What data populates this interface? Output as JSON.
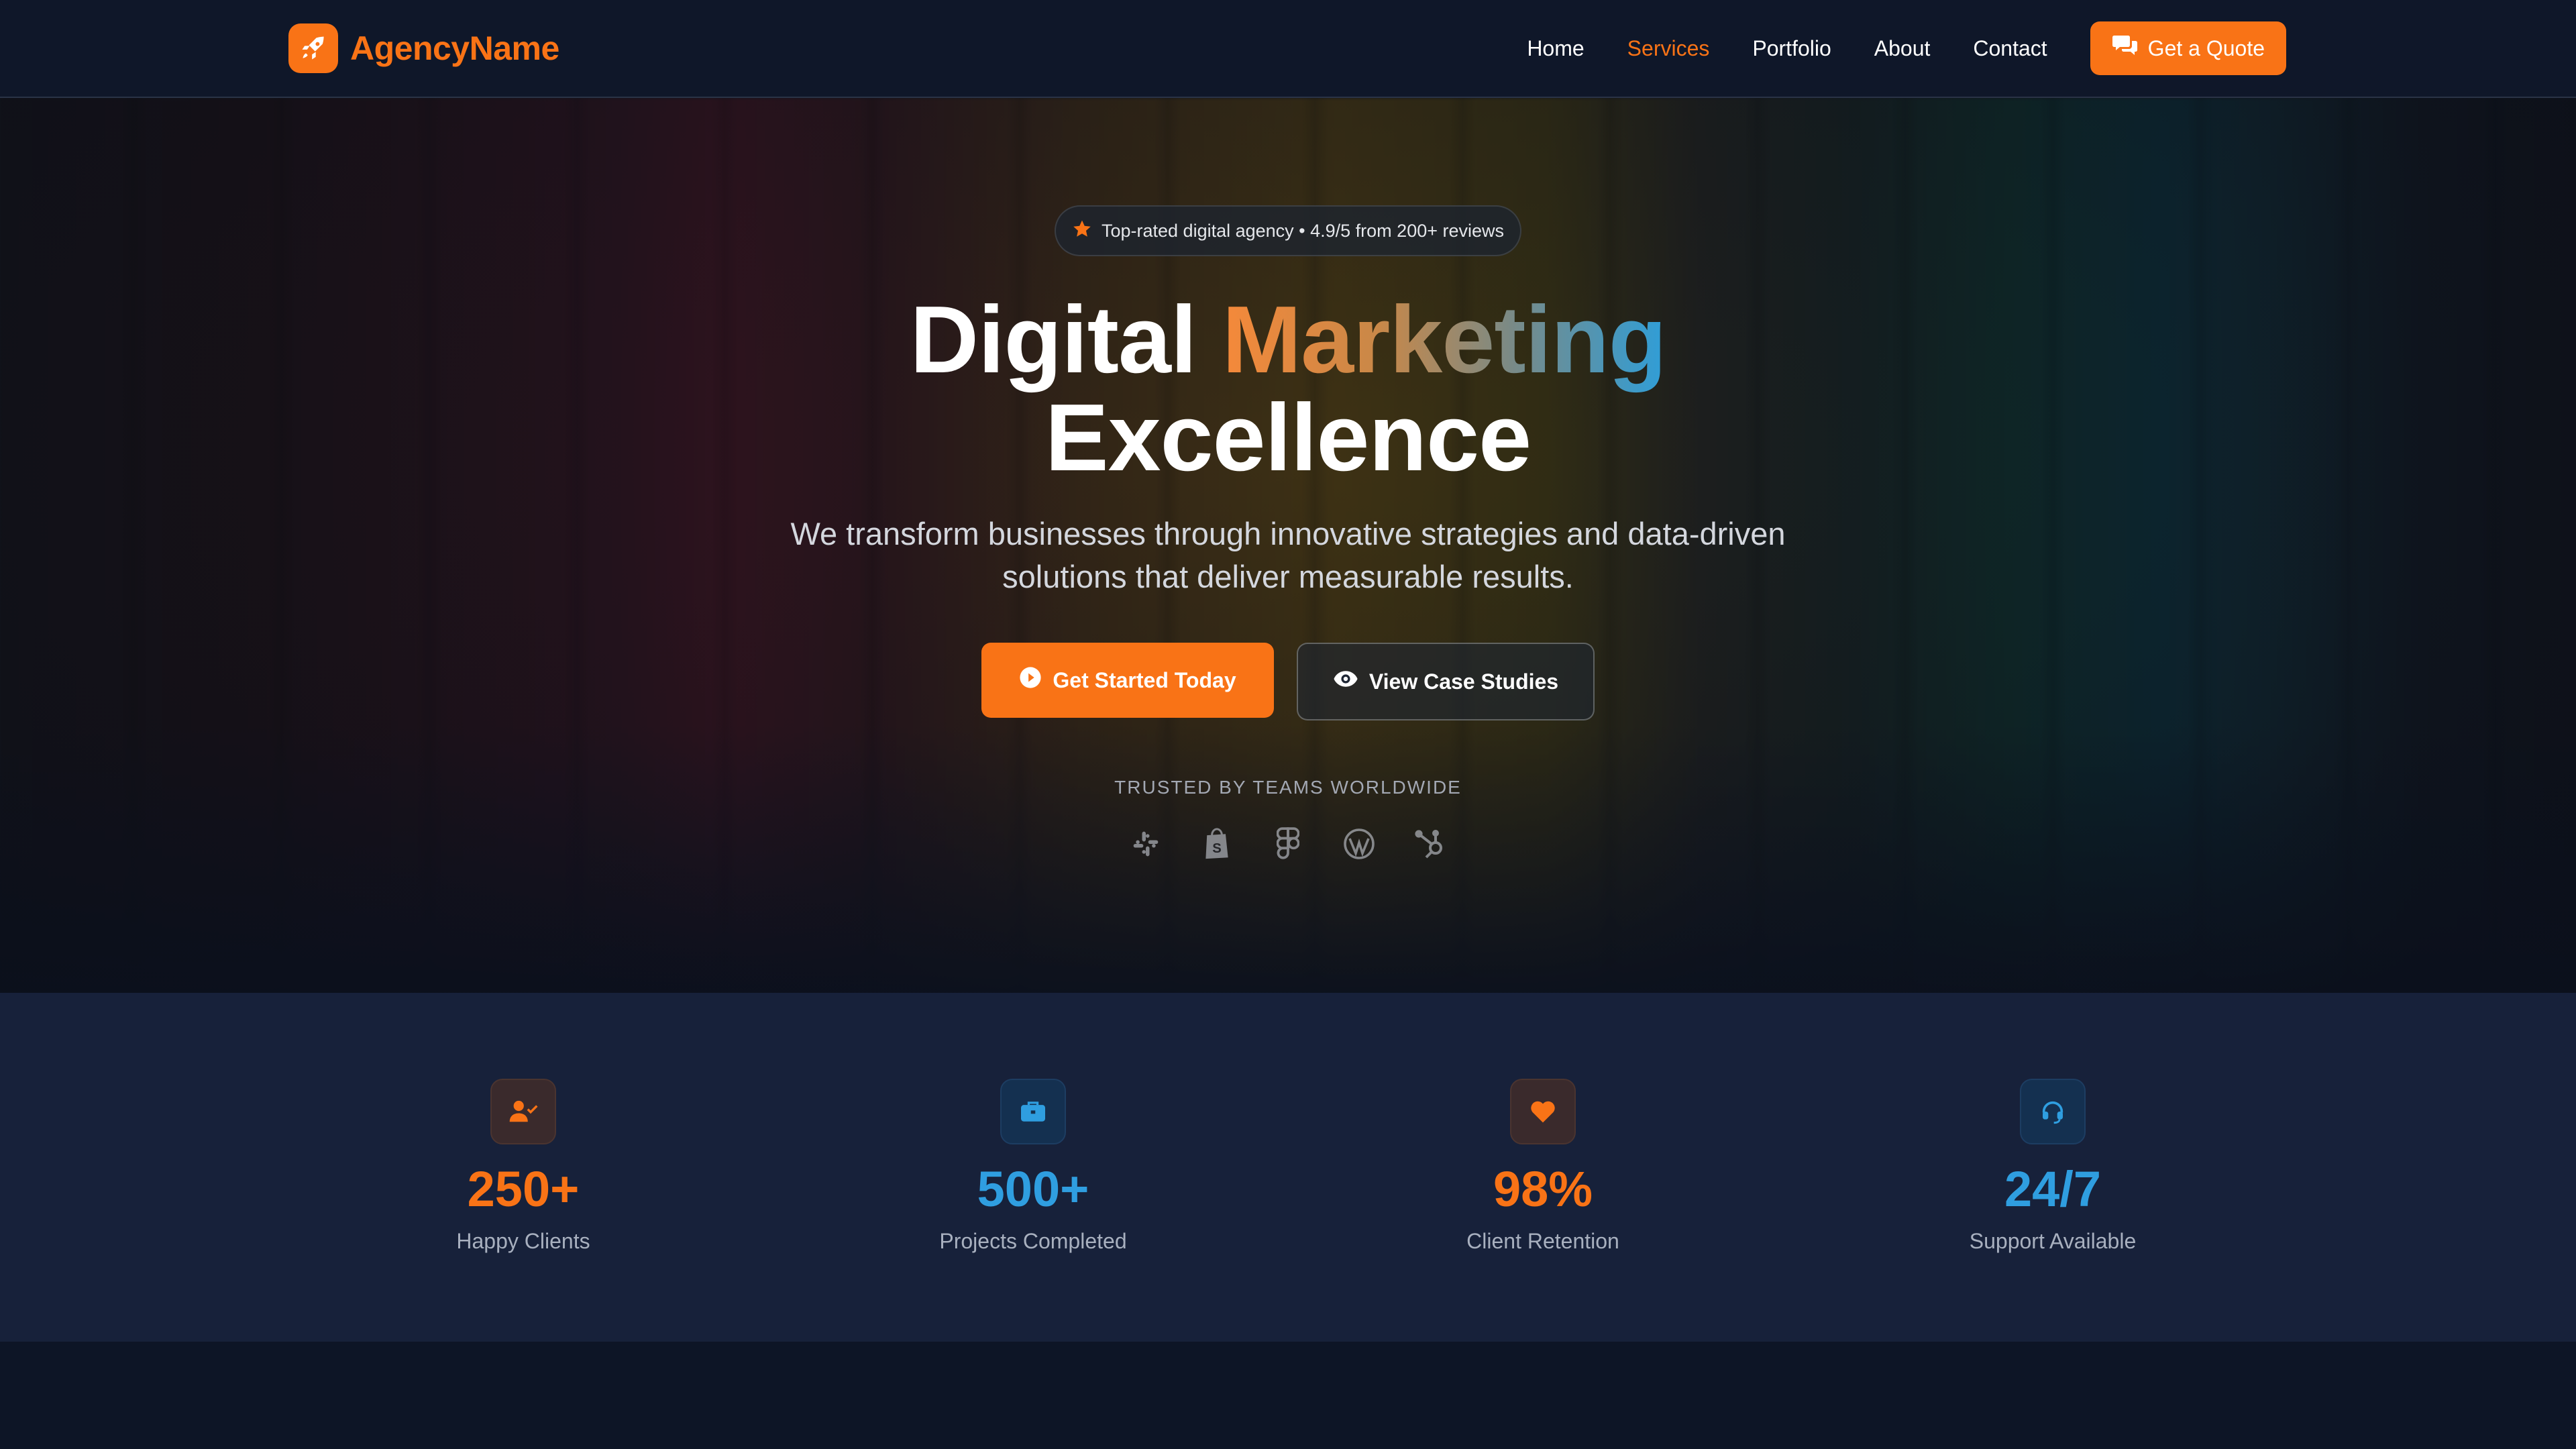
{
  "brand": {
    "name": "AgencyName",
    "logo_icon": "rocket-icon"
  },
  "nav": {
    "links": [
      "Home",
      "Services",
      "Portfolio",
      "About",
      "Contact"
    ],
    "active": "Services",
    "quote_label": "Get a Quote",
    "quote_icon": "comments-icon"
  },
  "hero": {
    "rating_text": "Top-rated digital agency • 4.9/5 from 200+ reviews",
    "title_part1": "Digital",
    "title_highlight": "Marketing",
    "title_line2": "Excellence",
    "subtitle_line1": "We transform businesses through innovative strategies and data-driven",
    "subtitle_line2": "solutions that deliver measurable results.",
    "primary_cta": "Get Started Today",
    "secondary_cta": "View Case Studies",
    "trusted_label": "TRUSTED BY TEAMS WORLDWIDE",
    "partner_logos": [
      "slack-icon",
      "shopify-icon",
      "figma-icon",
      "wordpress-icon",
      "hubspot-icon"
    ]
  },
  "stats": [
    {
      "value": "250+",
      "label": "Happy Clients",
      "icon": "user-check-icon",
      "color": "#f97316"
    },
    {
      "value": "500+",
      "label": "Projects Completed",
      "icon": "briefcase-icon",
      "color": "#2f9ee0"
    },
    {
      "value": "98%",
      "label": "Client Retention",
      "icon": "heart-icon",
      "color": "#f97316"
    },
    {
      "value": "24/7",
      "label": "Support Available",
      "icon": "headset-icon",
      "color": "#2f9ee0"
    }
  ],
  "colors": {
    "accent": "#f97316",
    "secondary": "#2f9ee0",
    "background": "#0d1526"
  }
}
